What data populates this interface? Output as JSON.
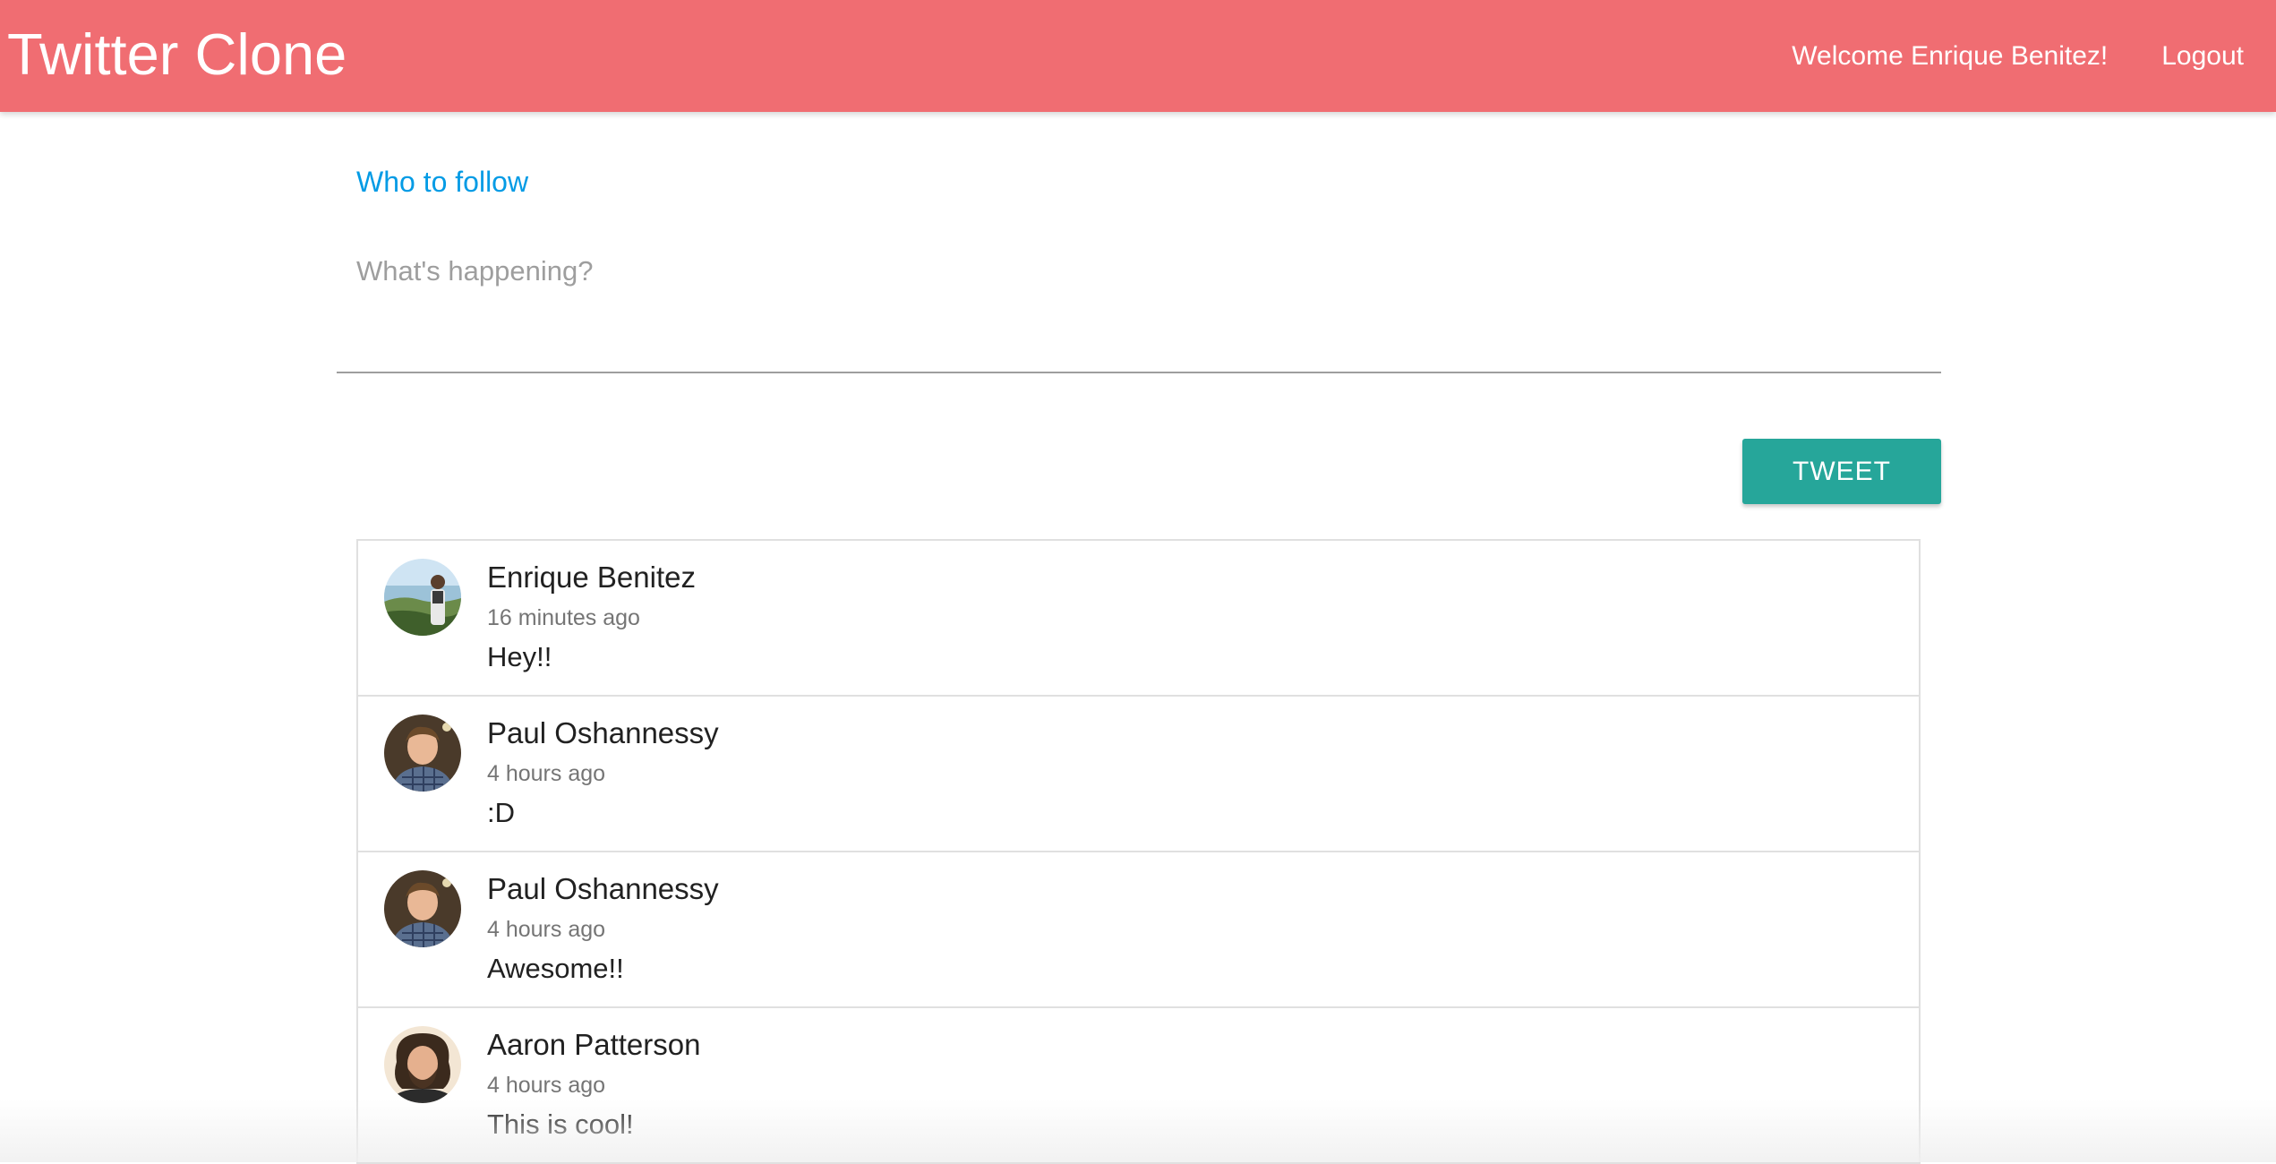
{
  "header": {
    "brand": "Twitter Clone",
    "welcome": "Welcome Enrique Benitez!",
    "logout": "Logout",
    "color": "#f06d72"
  },
  "main": {
    "who_to_follow": "Who to follow",
    "composer": {
      "placeholder": "What's happening?",
      "value": ""
    },
    "tweet_button": "TWEET",
    "tweet_button_color": "#26a69a"
  },
  "feed": [
    {
      "name": "Enrique Benitez",
      "time": "16 minutes ago",
      "text": "Hey!!",
      "avatar": "avatar-enrique"
    },
    {
      "name": "Paul Oshannessy",
      "time": "4 hours ago",
      "text": ":D",
      "avatar": "avatar-paul"
    },
    {
      "name": "Paul Oshannessy",
      "time": "4 hours ago",
      "text": "Awesome!!",
      "avatar": "avatar-paul"
    },
    {
      "name": "Aaron Patterson",
      "time": "4 hours ago",
      "text": "This is cool!",
      "avatar": "avatar-aaron"
    }
  ]
}
